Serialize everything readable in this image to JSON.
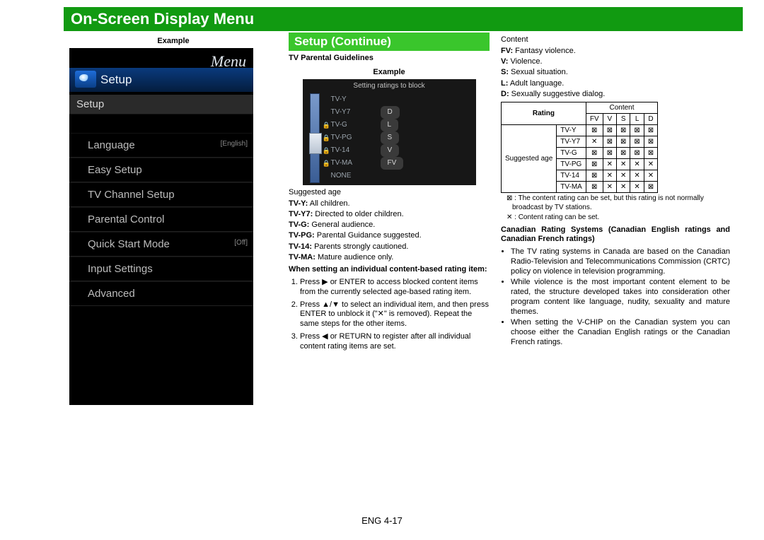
{
  "header": {
    "title": "On-Screen Display Menu"
  },
  "leftCol": {
    "exampleLabel": "Example",
    "menuTitle": "Menu",
    "setupHdr": "Setup",
    "subSetup": "Setup",
    "items": [
      {
        "label": "Language",
        "note": "[English]"
      },
      {
        "label": "Easy Setup",
        "note": ""
      },
      {
        "label": "TV Channel Setup",
        "note": ""
      },
      {
        "label": "Parental Control",
        "note": ""
      },
      {
        "label": "Quick Start Mode",
        "note": "[Off]"
      },
      {
        "label": "Input Settings",
        "note": ""
      },
      {
        "label": "Advanced",
        "note": ""
      }
    ]
  },
  "midCol": {
    "sectionLabel": "Setup (Continue)",
    "pgTitle": "TV Parental Guidelines",
    "exampleLabel": "Example",
    "shot": {
      "title": "Setting ratings to block",
      "rows": [
        {
          "lock": false,
          "label": "TV-Y",
          "pill": ""
        },
        {
          "lock": false,
          "label": "TV-Y7",
          "pill": "D"
        },
        {
          "lock": true,
          "label": "TV-G",
          "pill": "L"
        },
        {
          "lock": true,
          "label": "TV-PG",
          "pill": "S"
        },
        {
          "lock": true,
          "label": "TV-14",
          "pill": "V"
        },
        {
          "lock": true,
          "label": "TV-MA",
          "pill": "FV"
        },
        {
          "lock": false,
          "label": "NONE",
          "pill": ""
        }
      ]
    },
    "suggestedAgeLabel": "Suggested age",
    "ageDefs": [
      {
        "k": "TV-Y:",
        "v": " All children."
      },
      {
        "k": "TV-Y7:",
        "v": " Directed to older children."
      },
      {
        "k": "TV-G:",
        "v": " General audience."
      },
      {
        "k": "TV-PG:",
        "v": " Parental Guidance suggested."
      },
      {
        "k": "TV-14:",
        "v": " Parents strongly cautioned."
      },
      {
        "k": "TV-MA:",
        "v": " Mature audience only."
      }
    ],
    "whenSetting": "When setting an individual content-based rating item:",
    "steps": [
      "Press ▶ or ENTER to access blocked content items from the currently selected age-based rating item.",
      "Press ▲/▼ to select an individual item, and then press ENTER to unblock it (\"✕\" is removed). Repeat the same steps for the other items.",
      "Press ◀ or RETURN to register after all individual content rating items are set."
    ]
  },
  "rightCol": {
    "contentLabel": "Content",
    "contentDefs": [
      {
        "k": "FV:",
        "v": " Fantasy violence."
      },
      {
        "k": "V:",
        "v": " Violence."
      },
      {
        "k": "S:",
        "v": " Sexual situation."
      },
      {
        "k": "L:",
        "v": " Adult language."
      },
      {
        "k": "D:",
        "v": " Sexually suggestive dialog."
      }
    ],
    "table": {
      "ratingHeader": "Rating",
      "contentHeader": "Content",
      "cols": [
        "FV",
        "V",
        "S",
        "L",
        "D"
      ],
      "sideLabel": "Suggested age",
      "rows": [
        {
          "label": "TV-Y",
          "cells": [
            "⊠",
            "⊠",
            "⊠",
            "⊠",
            "⊠"
          ]
        },
        {
          "label": "TV-Y7",
          "cells": [
            "✕",
            "⊠",
            "⊠",
            "⊠",
            "⊠"
          ]
        },
        {
          "label": "TV-G",
          "cells": [
            "⊠",
            "⊠",
            "⊠",
            "⊠",
            "⊠"
          ]
        },
        {
          "label": "TV-PG",
          "cells": [
            "⊠",
            "✕",
            "✕",
            "✕",
            "✕"
          ]
        },
        {
          "label": "TV-14",
          "cells": [
            "⊠",
            "✕",
            "✕",
            "✕",
            "✕"
          ]
        },
        {
          "label": "TV-MA",
          "cells": [
            "⊠",
            "✕",
            "✕",
            "✕",
            "⊠"
          ]
        }
      ]
    },
    "note1a": "⊠ : The content rating can be set, but this rating is not normally broadcast by TV stations.",
    "note1b": "✕ : Content rating can be set.",
    "canHeading": "Canadian Rating Systems (Canadian English ratings and Canadian French ratings)",
    "bullets": [
      "The TV rating systems in Canada are based on the Canadian Radio-Television and Telecommunications Commission (CRTC) policy on violence in television programming.",
      "While violence is the most important content element to be rated, the structure developed takes into consideration other program content like language, nudity, sexuality and mature themes.",
      "When setting the V-CHIP on the Canadian system you can choose either the Canadian English ratings or the Canadian French ratings."
    ]
  },
  "footer": {
    "text": "ENG 4-17"
  }
}
